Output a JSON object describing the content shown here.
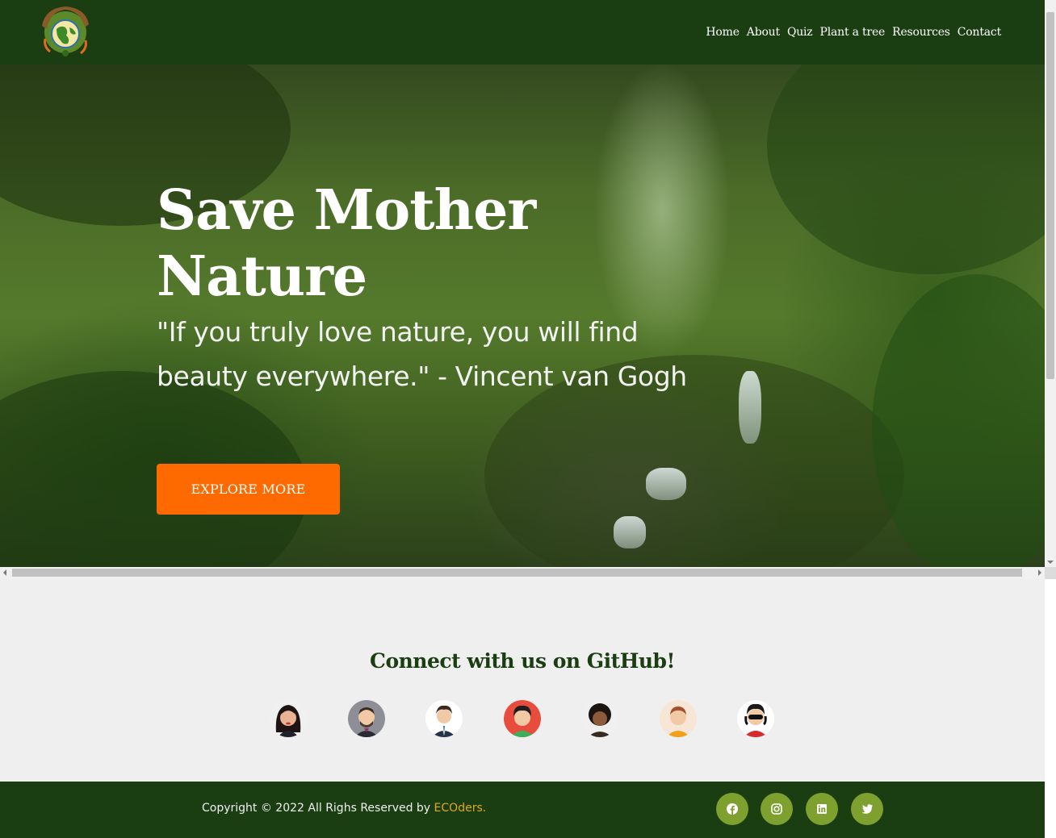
{
  "header": {
    "nav": [
      "Home",
      "About",
      "Quiz",
      "Plant a tree",
      "Resources",
      "Contact"
    ]
  },
  "hero": {
    "title_line1": "Save Mother",
    "title_line2": "Nature",
    "quote": "\"If you truly love nature, you will find beauty everywhere.\" - Vincent van Gogh",
    "cta": "EXPLORE MORE"
  },
  "github": {
    "title": "Connect with us on GitHub!"
  },
  "footer": {
    "copyright": "Copyright © 2022 All Righs Reserved by ",
    "brand": "ECOders."
  },
  "colors": {
    "primary": "#1a3d12",
    "accent": "#ff6a00",
    "brand_text": "#e0a91c",
    "social_bg": "#7da02f"
  },
  "icons": [
    "earth-logo-icon",
    "facebook-icon",
    "instagram-icon",
    "linkedin-icon",
    "twitter-icon"
  ]
}
